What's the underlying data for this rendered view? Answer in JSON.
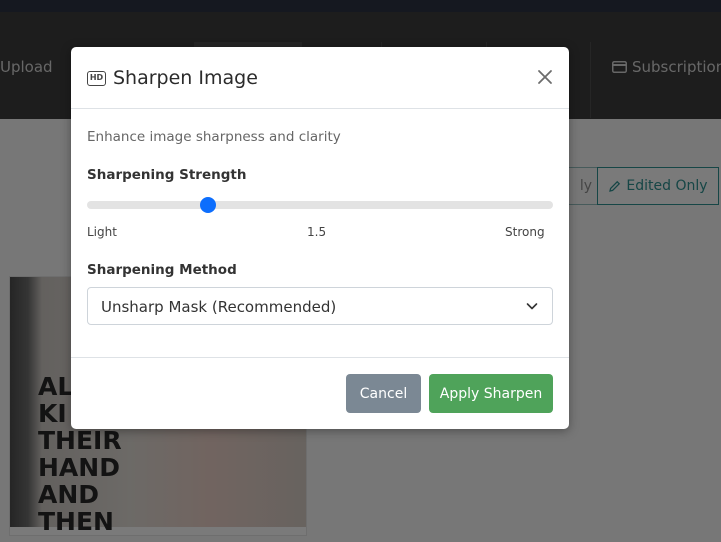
{
  "nav": {
    "upload": "Upload",
    "subscription": "Subscription"
  },
  "filters": {
    "partial_label": "ly",
    "edited_only": "Edited Only"
  },
  "thumbnail": {
    "text_lines": [
      "AL",
      "KI",
      "THEIR",
      "HAND",
      "AND",
      "THEN"
    ]
  },
  "modal": {
    "title": "Sharpen Image",
    "description": "Enhance image sharpness and clarity",
    "strength": {
      "label": "Sharpening Strength",
      "min_label": "Light",
      "value_label": "1.5",
      "max_label": "Strong",
      "value_fraction": 0.26
    },
    "method": {
      "label": "Sharpening Method",
      "selected": "Unsharp Mask (Recommended)"
    },
    "buttons": {
      "cancel": "Cancel",
      "apply": "Apply Sharpen"
    }
  },
  "colors": {
    "slider_accent": "#0d6efd",
    "apply": "#4fa35a",
    "cancel": "#7b8894",
    "filter_accent": "#2c8d8d"
  },
  "icons": {
    "title": "hd-icon",
    "close": "close-icon",
    "select": "chevron-down-icon",
    "edited": "pencil-icon",
    "subscription": "credit-card-icon"
  }
}
